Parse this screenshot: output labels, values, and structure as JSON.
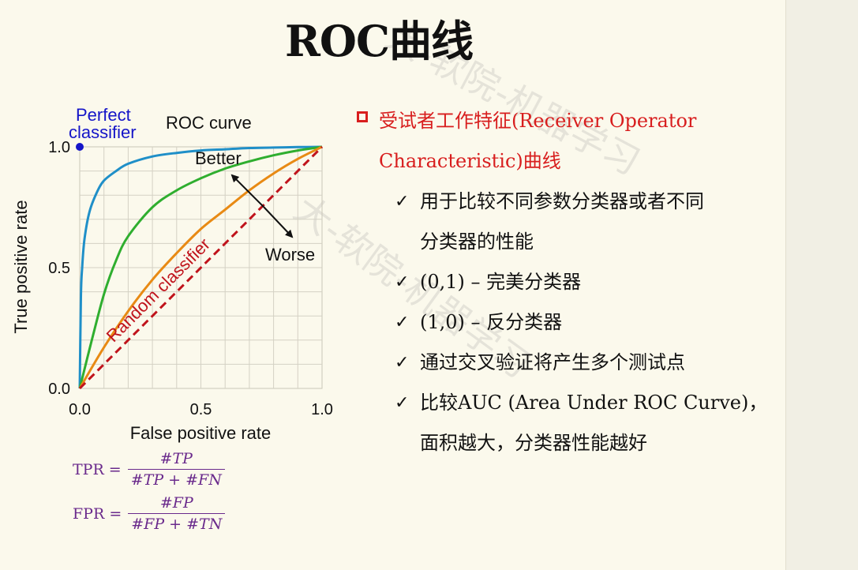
{
  "title": "ROC曲线",
  "watermark": "大-软院-机器学习",
  "chart_data": {
    "type": "line",
    "title": "ROC curve",
    "xlabel": "False positive rate",
    "ylabel": "True positive rate",
    "xlim": [
      0,
      1
    ],
    "ylim": [
      0,
      1
    ],
    "x_ticks": [
      "0.0",
      "0.5",
      "1.0"
    ],
    "y_ticks": [
      "0.0",
      "0.5",
      "1.0"
    ],
    "grid": true,
    "series": [
      {
        "color": "#1f8fc8",
        "x": [
          0,
          0.005,
          0.01,
          0.02,
          0.04,
          0.07,
          0.1,
          0.15,
          0.2,
          0.3,
          0.4,
          0.5,
          0.6,
          0.7,
          0.8,
          0.9,
          1.0
        ],
        "y": [
          0,
          0.38,
          0.5,
          0.62,
          0.73,
          0.81,
          0.86,
          0.9,
          0.93,
          0.96,
          0.975,
          0.985,
          0.99,
          0.995,
          0.997,
          0.999,
          1.0
        ]
      },
      {
        "color": "#2fae2f",
        "x": [
          0,
          0.05,
          0.1,
          0.15,
          0.2,
          0.3,
          0.4,
          0.5,
          0.6,
          0.7,
          0.8,
          0.9,
          1.0
        ],
        "y": [
          0,
          0.2,
          0.39,
          0.53,
          0.63,
          0.75,
          0.82,
          0.87,
          0.91,
          0.94,
          0.965,
          0.985,
          1.0
        ]
      },
      {
        "color": "#e88a14",
        "x": [
          0,
          0.1,
          0.2,
          0.3,
          0.4,
          0.5,
          0.6,
          0.7,
          0.8,
          0.9,
          1.0
        ],
        "y": [
          0,
          0.17,
          0.32,
          0.45,
          0.56,
          0.66,
          0.74,
          0.82,
          0.89,
          0.95,
          1.0
        ]
      },
      {
        "name": "Random classifier",
        "color": "#c0141c",
        "dashed": true,
        "x": [
          0,
          1
        ],
        "y": [
          0,
          1
        ]
      }
    ],
    "points": [
      {
        "label": "Perfect classifier",
        "x": 0,
        "y": 1,
        "color": "#1515c8"
      }
    ],
    "annotations": [
      "Better",
      "Worse"
    ]
  },
  "formulas": [
    {
      "lhs": "TPR =",
      "num": "#TP",
      "den": "#TP + #FN"
    },
    {
      "lhs": "FPR =",
      "num": "#FP",
      "den": "#FP + #TN"
    }
  ],
  "main_bullet": {
    "line1": "受试者工作特征(Receiver Operator",
    "line2": "Characteristic)曲线"
  },
  "sub_bullets": [
    "用于比较不同参数分类器或者不同",
    "分类器的性能",
    "(0,1) – 完美分类器",
    "(1,0) – 反分类器",
    "通过交叉验证将产生多个测试点",
    "比较AUC (Area Under ROC Curve)，",
    "面积越大，分类器性能越好"
  ],
  "check_mark": "✓",
  "colors": {
    "accent": "#d81e1e",
    "formula": "#6a2a8c",
    "background": "#fbf9ec"
  }
}
